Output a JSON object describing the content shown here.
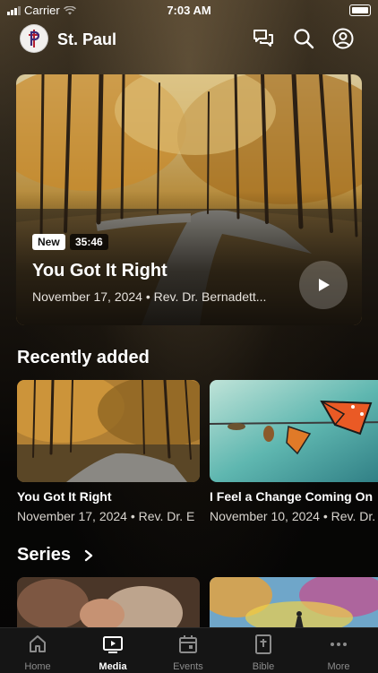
{
  "status_bar": {
    "carrier": "Carrier",
    "time": "7:03 AM"
  },
  "header": {
    "church_name": "St. Paul",
    "logo_letter": "P"
  },
  "featured": {
    "badge_new": "New",
    "duration": "35:46",
    "title": "You Got It Right",
    "meta": "November 17, 2024 • Rev. Dr. Bernadett..."
  },
  "recently_added": {
    "heading": "Recently added",
    "items": [
      {
        "title": "You Got It Right",
        "meta": "November 17, 2024 • Rev. Dr. E"
      },
      {
        "title": "I Feel a Change Coming On",
        "meta": "November 10, 2024 • Rev. Dr."
      }
    ]
  },
  "series": {
    "heading": "Series"
  },
  "tabbar": {
    "items": [
      {
        "label": "Home",
        "icon": "home-icon"
      },
      {
        "label": "Media",
        "icon": "media-icon",
        "active": true
      },
      {
        "label": "Events",
        "icon": "calendar-icon"
      },
      {
        "label": "Bible",
        "icon": "bible-icon"
      },
      {
        "label": "More",
        "icon": "more-icon"
      }
    ]
  },
  "colors": {
    "background": "#0a0806",
    "tabbar": "#151515",
    "accent_autumn": "#c98a2b"
  }
}
